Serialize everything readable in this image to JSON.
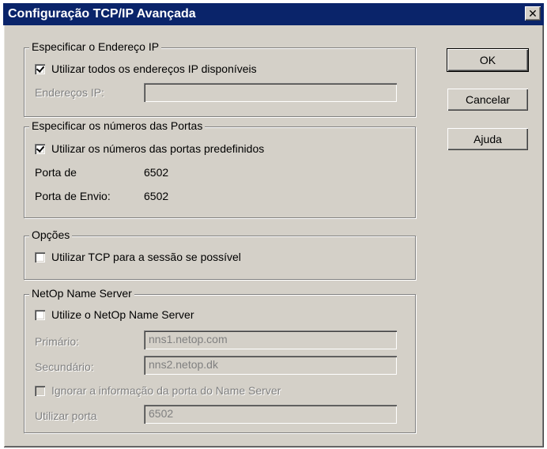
{
  "window": {
    "title": "Configuração TCP/IP Avançada",
    "close_glyph": "✕"
  },
  "ip_group": {
    "label": "Especificar o Endereço IP",
    "use_all_label": "Utilizar todos os endereços IP disponíveis",
    "use_all_checked": true,
    "addresses_label": "Endereços IP:",
    "addresses_value": ""
  },
  "ports_group": {
    "label": "Especificar os números das Portas",
    "use_default_label": "Utilizar os números das portas predefinidos",
    "use_default_checked": true,
    "port_from_label": "Porta de",
    "port_from_value": "6502",
    "port_send_label": "Porta de Envio:",
    "port_send_value": "6502"
  },
  "options_group": {
    "label": "Opções",
    "tcp_session_label": "Utilizar TCP para a sessão se possível",
    "tcp_session_checked": false
  },
  "nameserver_group": {
    "label": "NetOp Name Server",
    "use_ns_label": "Utilize o NetOp Name Server",
    "use_ns_checked": false,
    "primary_label": "Primário:",
    "primary_value": "nns1.netop.com",
    "secondary_label": "Secundário:",
    "secondary_value": "nns2.netop.dk",
    "ignore_port_label": "Ignorar a informação da porta do Name Server",
    "use_port_label": "Utilizar porta",
    "use_port_value": "6502"
  },
  "buttons": {
    "ok": "OK",
    "cancel": "Cancelar",
    "help": "Ajuda"
  }
}
